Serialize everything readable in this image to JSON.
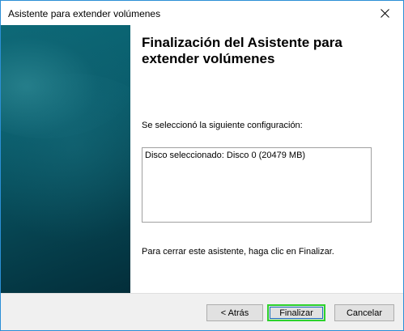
{
  "window": {
    "title": "Asistente para extender volúmenes"
  },
  "main": {
    "heading": "Finalización del Asistente para extender volúmenes",
    "config_label": "Se seleccionó la siguiente configuración:",
    "config_lines": [
      "Disco seleccionado: Disco 0 (20479 MB)"
    ],
    "finish_instruction": "Para cerrar este asistente, haga clic en Finalizar."
  },
  "buttons": {
    "back": "< Atrás",
    "finish": "Finalizar",
    "cancel": "Cancelar"
  },
  "colors": {
    "side_panel": "#0a5d6c",
    "finish_highlight": "#2dd22d",
    "window_border": "#2b8fd6"
  }
}
